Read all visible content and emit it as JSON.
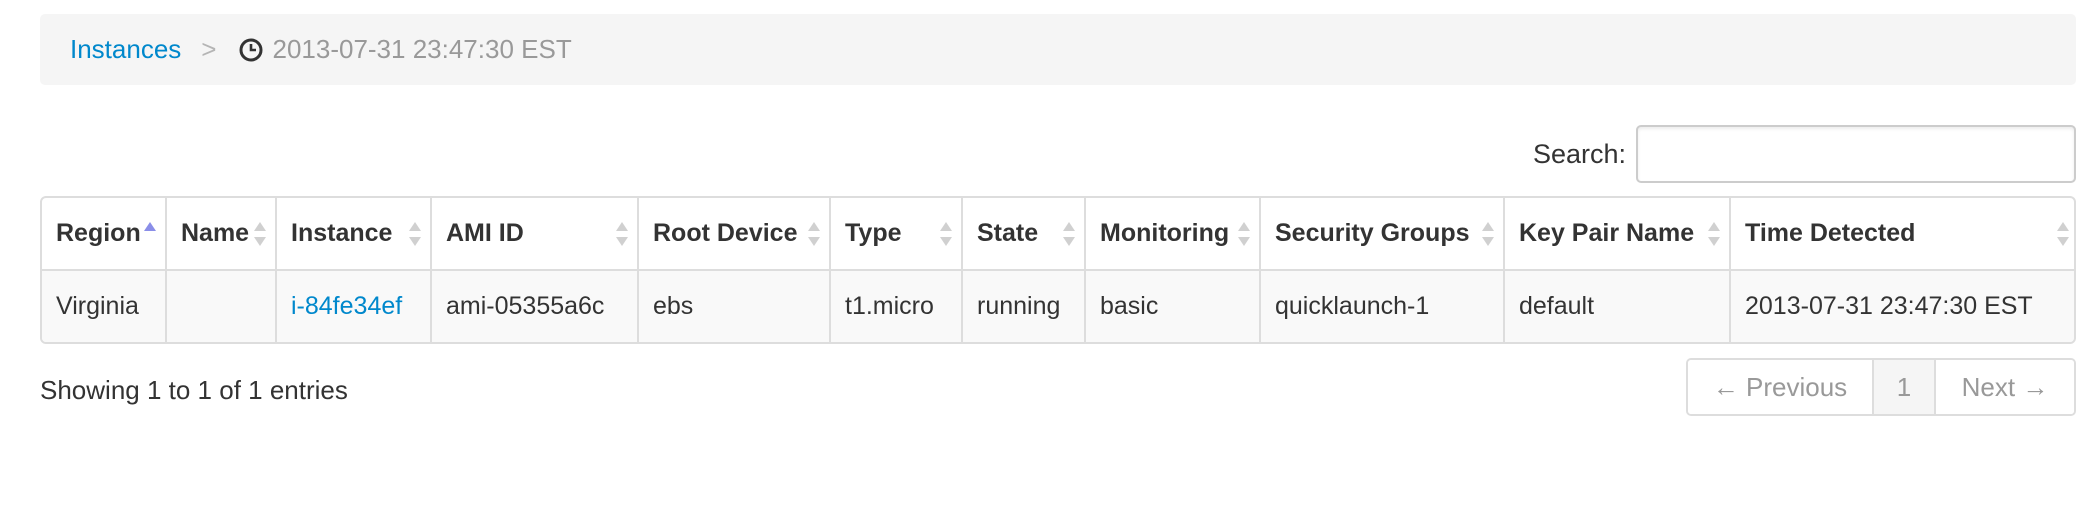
{
  "breadcrumb": {
    "link": "Instances",
    "separator": ">",
    "current": "2013-07-31 23:47:30 EST"
  },
  "search": {
    "label": "Search:",
    "value": "",
    "placeholder": ""
  },
  "table": {
    "columns": [
      {
        "label": "Region",
        "sort": "asc"
      },
      {
        "label": "Name",
        "sort": "both"
      },
      {
        "label": "Instance",
        "sort": "both"
      },
      {
        "label": "AMI ID",
        "sort": "both"
      },
      {
        "label": "Root Device",
        "sort": "both"
      },
      {
        "label": "Type",
        "sort": "both"
      },
      {
        "label": "State",
        "sort": "both"
      },
      {
        "label": "Monitoring",
        "sort": "both"
      },
      {
        "label": "Security Groups",
        "sort": "both"
      },
      {
        "label": "Key Pair Name",
        "sort": "both"
      },
      {
        "label": "Time Detected",
        "sort": "both"
      }
    ],
    "rows": [
      [
        "Virginia",
        "",
        "i-84fe34ef",
        "ami-05355a6c",
        "ebs",
        "t1.micro",
        "running",
        "basic",
        "quicklaunch-1",
        "default",
        "2013-07-31 23:47:30 EST"
      ]
    ]
  },
  "footer": {
    "info": "Showing 1 to 1 of 1 entries",
    "prev": "← Previous",
    "page": "1",
    "next": "Next →"
  },
  "colors": {
    "link": "#0088cc",
    "sort_active": "#8a8ee8",
    "sort_inactive": "#d0d0d0"
  }
}
